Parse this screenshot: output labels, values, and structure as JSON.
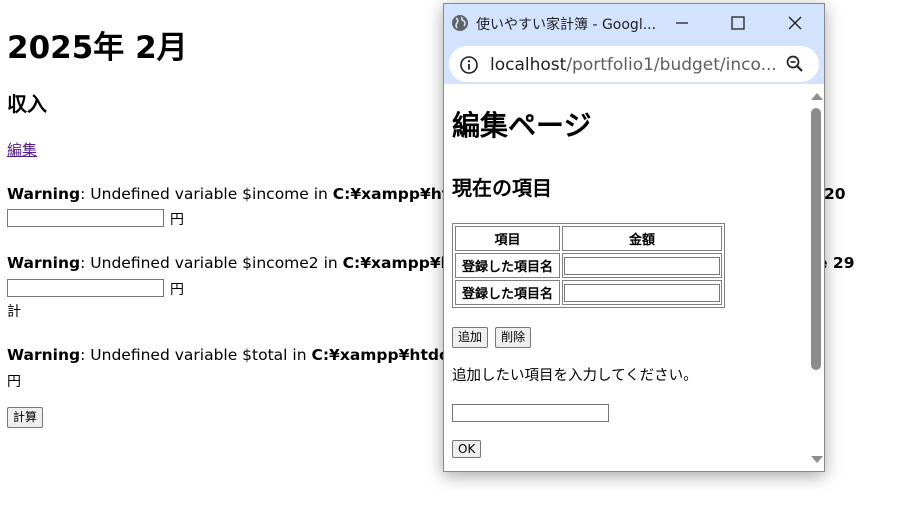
{
  "page": {
    "heading": "2025年 2月",
    "section_title": "収入",
    "edit_link": "編集",
    "warnings": [
      {
        "label": "Warning",
        "message": ": Undefined variable $income in ",
        "path": "C:¥xampp¥htdoc",
        "tail": "20"
      },
      {
        "label": "Warning",
        "message": ": Undefined variable $income2 in ",
        "path": "C:¥xampp¥htdo",
        "tail": "e 29"
      },
      {
        "label": "Warning",
        "message": ": Undefined variable $total in ",
        "path": "C:¥xampp¥htdocs¥",
        "tail": ""
      }
    ],
    "yen": "円",
    "total_label": "計",
    "calc_button": "計算"
  },
  "popup": {
    "window_title": "使いやすい家計簿 - Googl...",
    "url_host": "localhost",
    "url_path": "/portfolio1/budget/inco...",
    "heading": "編集ページ",
    "subheading": "現在の項目",
    "table": {
      "headers": [
        "項目",
        "金額"
      ],
      "rows": [
        {
          "label": "登録した項目名",
          "value": ""
        },
        {
          "label": "登録した項目名",
          "value": ""
        }
      ]
    },
    "add_button": "追加",
    "delete_button": "削除",
    "prompt": "追加したい項目を入力してください。",
    "new_item_value": "",
    "ok_button": "OK"
  },
  "icons": {
    "globe": "globe-icon",
    "minimize": "minimize-icon",
    "maximize": "maximize-icon",
    "close": "close-icon",
    "site_info": "info-icon",
    "zoom": "zoom-icon"
  },
  "colors": {
    "titlebar": "#d3e3fd",
    "link_visited": "#551a8b",
    "scroll_thumb": "#8c8c8c"
  }
}
